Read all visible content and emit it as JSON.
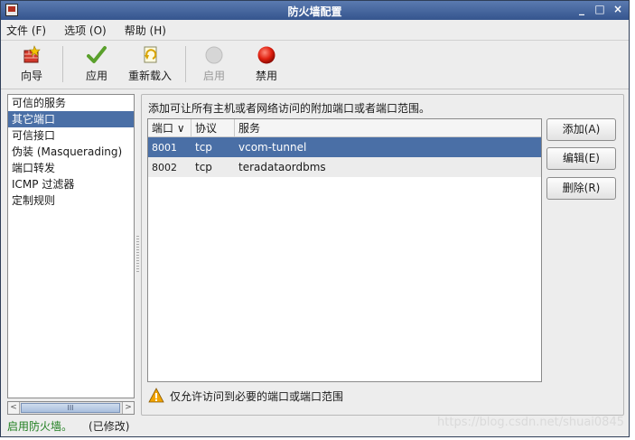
{
  "window": {
    "title": "防火墙配置",
    "controls": {
      "minimize": "_",
      "maximize": "□",
      "close": "×"
    }
  },
  "menubar": [
    "文件 (F)",
    "选项 (O)",
    "帮助 (H)"
  ],
  "toolbar": {
    "wizard": "向导",
    "apply": "应用",
    "reload": "重新载入",
    "enable": "启用",
    "disable": "禁用"
  },
  "sidebar": {
    "items": [
      {
        "label": "可信的服务"
      },
      {
        "label": "其它端口",
        "selected": true
      },
      {
        "label": "可信接口"
      },
      {
        "label": "伪装 (Masquerading)"
      },
      {
        "label": "端口转发"
      },
      {
        "label": "ICMP 过滤器"
      },
      {
        "label": "定制规则"
      }
    ],
    "scroll_thumb": "III"
  },
  "main": {
    "description": "添加可让所有主机或者网络访问的附加端口或者端口范围。",
    "columns": {
      "port": "端口 ∨",
      "protocol": "协议",
      "service": "服务"
    },
    "rows": [
      {
        "port": "8001",
        "protocol": "tcp",
        "service": "vcom-tunnel",
        "selected": true
      },
      {
        "port": "8002",
        "protocol": "tcp",
        "service": "teradataordbms"
      }
    ],
    "buttons": {
      "add": "添加(A)",
      "edit": "编辑(E)",
      "remove": "删除(R)"
    },
    "warning": "仅允许访问到必要的端口或端口范围"
  },
  "statusbar": {
    "state": "启用防火墙。",
    "modified": "(已修改)"
  },
  "watermark": "https://blog.csdn.net/shuai0845",
  "colors": {
    "titlebar": "#35558e",
    "selection": "#4a6fa6",
    "status_on": "#1e7e1e"
  }
}
